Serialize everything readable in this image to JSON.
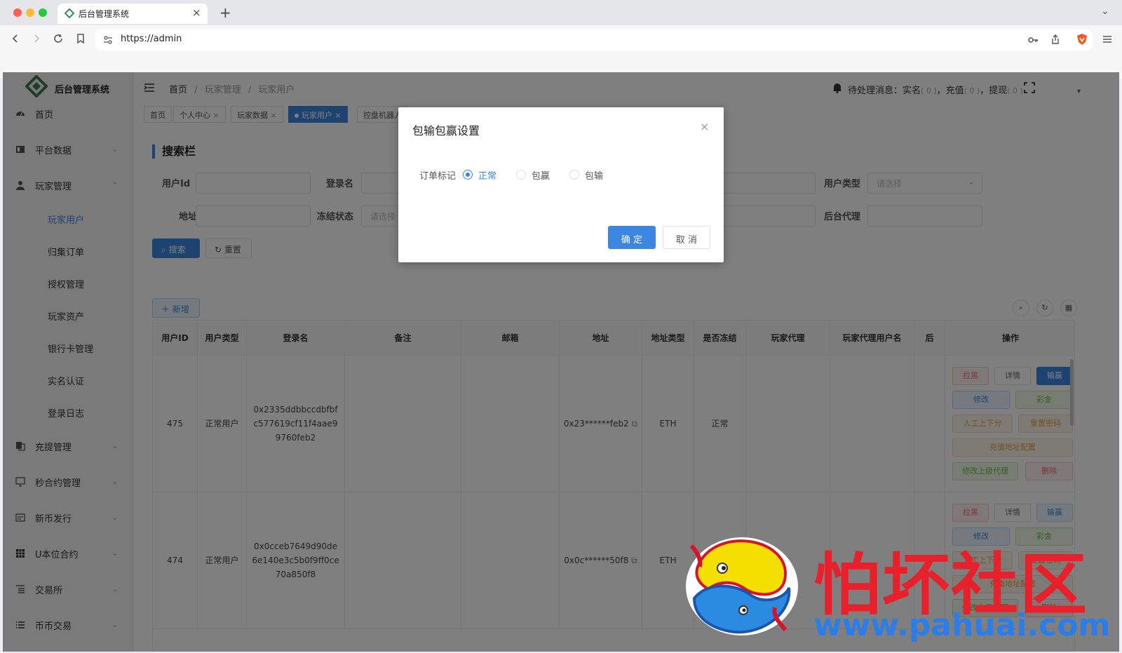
{
  "browser": {
    "tab_title": "后台管理系统",
    "url": "https://admin"
  },
  "app": {
    "logo_title": "后台管理系统",
    "sidebar": {
      "items": [
        {
          "label": "首页",
          "icon": "dashboard-icon",
          "chevron": ""
        },
        {
          "label": "平台数据",
          "icon": "book-icon",
          "chevron": "⌄"
        },
        {
          "label": "玩家管理",
          "icon": "user-icon",
          "chevron": "⌃"
        },
        {
          "label": "充提管理",
          "icon": "copy-icon",
          "chevron": "⌄"
        },
        {
          "label": "秒合约管理",
          "icon": "monitor-icon",
          "chevron": "⌄"
        },
        {
          "label": "新币发行",
          "icon": "card-icon",
          "chevron": "⌄"
        },
        {
          "label": "U本位合约",
          "icon": "grid-icon",
          "chevron": "⌄"
        },
        {
          "label": "交易所",
          "icon": "list-icon",
          "chevron": "⌄"
        },
        {
          "label": "币币交易",
          "icon": "list-bullets-icon",
          "chevron": "⌄"
        }
      ],
      "sub_items": [
        "玩家用户",
        "归集订单",
        "授权管理",
        "玩家资产",
        "银行卡管理",
        "实名认证",
        "登录日志"
      ]
    },
    "breadcrumb": {
      "home": "首页",
      "sep": "/",
      "level1": "玩家管理",
      "level2": "玩家用户"
    },
    "notice": {
      "prefix": "待处理消息：",
      "realname": "实名",
      "realname_count": "( 0 )",
      "recharge": "充值",
      "recharge_count": "( 0 )",
      "withdraw": "提现",
      "withdraw_count": "( 0 )",
      "sep": "，"
    },
    "tags": [
      {
        "label": "首页",
        "close": ""
      },
      {
        "label": "个人中心",
        "close": "×"
      },
      {
        "label": "玩家数据",
        "close": "×"
      },
      {
        "label": "玩家用户",
        "close": "×"
      },
      {
        "label": "控盘机器人",
        "close": ""
      }
    ],
    "search": {
      "title": "搜索栏",
      "user_id_label": "用户Id",
      "login_name_label": "登录名",
      "user_type_label": "用户类型",
      "user_type_placeholder": "请选择",
      "address_label": "地址",
      "freeze_label": "冻结状态",
      "freeze_placeholder": "请选择",
      "agent_label": "后台代理",
      "search_button": "搜索",
      "reset_button": "重置"
    },
    "toolbar": {
      "add_button": "新增"
    },
    "table": {
      "headers": [
        "用户ID",
        "用户类型",
        "登录名",
        "备注",
        "邮箱",
        "地址",
        "地址类型",
        "是否冻结",
        "玩家代理",
        "玩家代理用户名",
        "后",
        "操作"
      ],
      "rows": [
        {
          "id": "475",
          "type": "正常用户",
          "login_name": [
            "0x2335ddbbccdbfbf",
            "c577619cf11f4aae9",
            "9760feb2"
          ],
          "address": "0x23******feb2",
          "addr_type": "ETH",
          "frozen": "正常"
        },
        {
          "id": "474",
          "type": "正常用户",
          "login_name": [
            "0x0cceb7649d90de",
            "6e140e3c5b0f9ff0ce",
            "70a850f8"
          ],
          "address": "0x0c******50f8",
          "addr_type": "ETH",
          "frozen": ""
        }
      ],
      "ops": {
        "blacklist": "拉黑",
        "detail": "详情",
        "win_lose": "输赢",
        "edit": "修改",
        "bonus": "彩金",
        "manual": "人工上下分",
        "reset_pwd": "重置密码",
        "deposit_addr": "充值地址配置",
        "edit_agent": "修改上级代理",
        "delete": "删除"
      }
    }
  },
  "dialog": {
    "title": "包输包赢设置",
    "field_label": "订单标记",
    "options": [
      {
        "label": "正常",
        "checked": true
      },
      {
        "label": "包赢",
        "checked": false
      },
      {
        "label": "包输",
        "checked": false
      }
    ],
    "confirm": "确 定",
    "cancel": "取 消",
    "close_symbol": "×"
  },
  "watermark": {
    "text": "怕坏社区",
    "url": "www.pahuai.com"
  },
  "colors": {
    "primary": "#3a86e0",
    "danger": "#e8202b",
    "success": "#67c23a",
    "warning": "#e6a23c"
  }
}
